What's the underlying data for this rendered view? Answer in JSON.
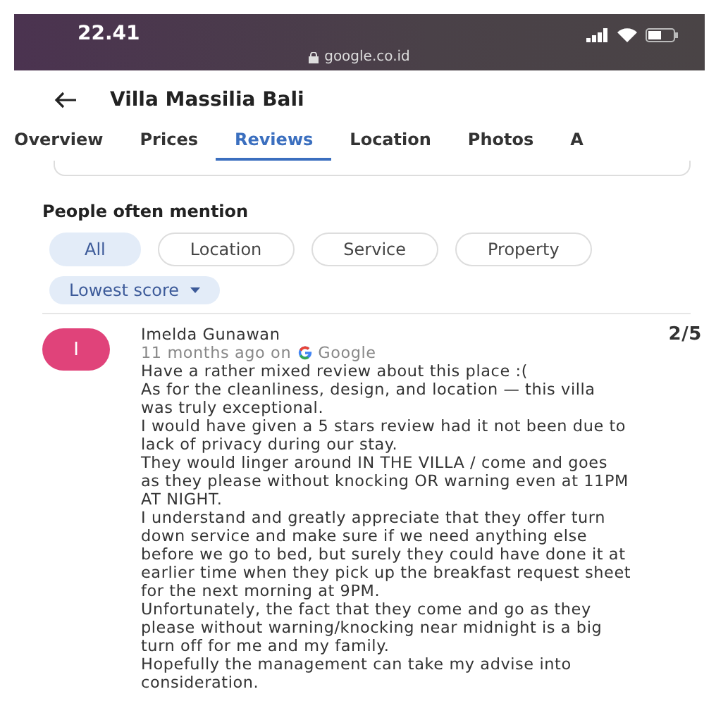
{
  "status_bar": {
    "time": "22.41",
    "url": "google.co.id"
  },
  "header": {
    "title": "Villa Massilia Bali"
  },
  "tabs": [
    {
      "label": "Overview",
      "selected": false
    },
    {
      "label": "Prices",
      "selected": false
    },
    {
      "label": "Reviews",
      "selected": true
    },
    {
      "label": "Location",
      "selected": false
    },
    {
      "label": "Photos",
      "selected": false
    },
    {
      "label": "A",
      "selected": false
    }
  ],
  "mentions": {
    "heading": "People often mention",
    "chips": [
      {
        "label": "All",
        "selected": true
      },
      {
        "label": "Location",
        "selected": false
      },
      {
        "label": "Service",
        "selected": false
      },
      {
        "label": "Property",
        "selected": false
      }
    ],
    "sort": "Lowest score"
  },
  "review": {
    "initial": "I",
    "author": "Imelda Gunawan",
    "time": "11 months ago on",
    "source": "Google",
    "score": "2/5",
    "paragraphs": [
      "Have a rather mixed review about this place :(",
      "As for the cleanliness, design, and location — this villa was truly exceptional.",
      "I would have given a 5 stars review had it not been due to lack of privacy during our stay.",
      "They would linger around IN THE VILLA / come and goes as they please without knocking OR warning even at 11PM AT NIGHT.",
      "I understand and greatly appreciate that they offer turn down service and make sure if we need anything else before we go to bed, but surely they could have done it at earlier time when they pick up the breakfast request sheet for the next morning at 9PM.",
      "Unfortunately, the fact that they come and go as they please without warning/knocking near midnight is a big turn off for me and my family.",
      "Hopefully the management can take my advise into consideration."
    ]
  }
}
